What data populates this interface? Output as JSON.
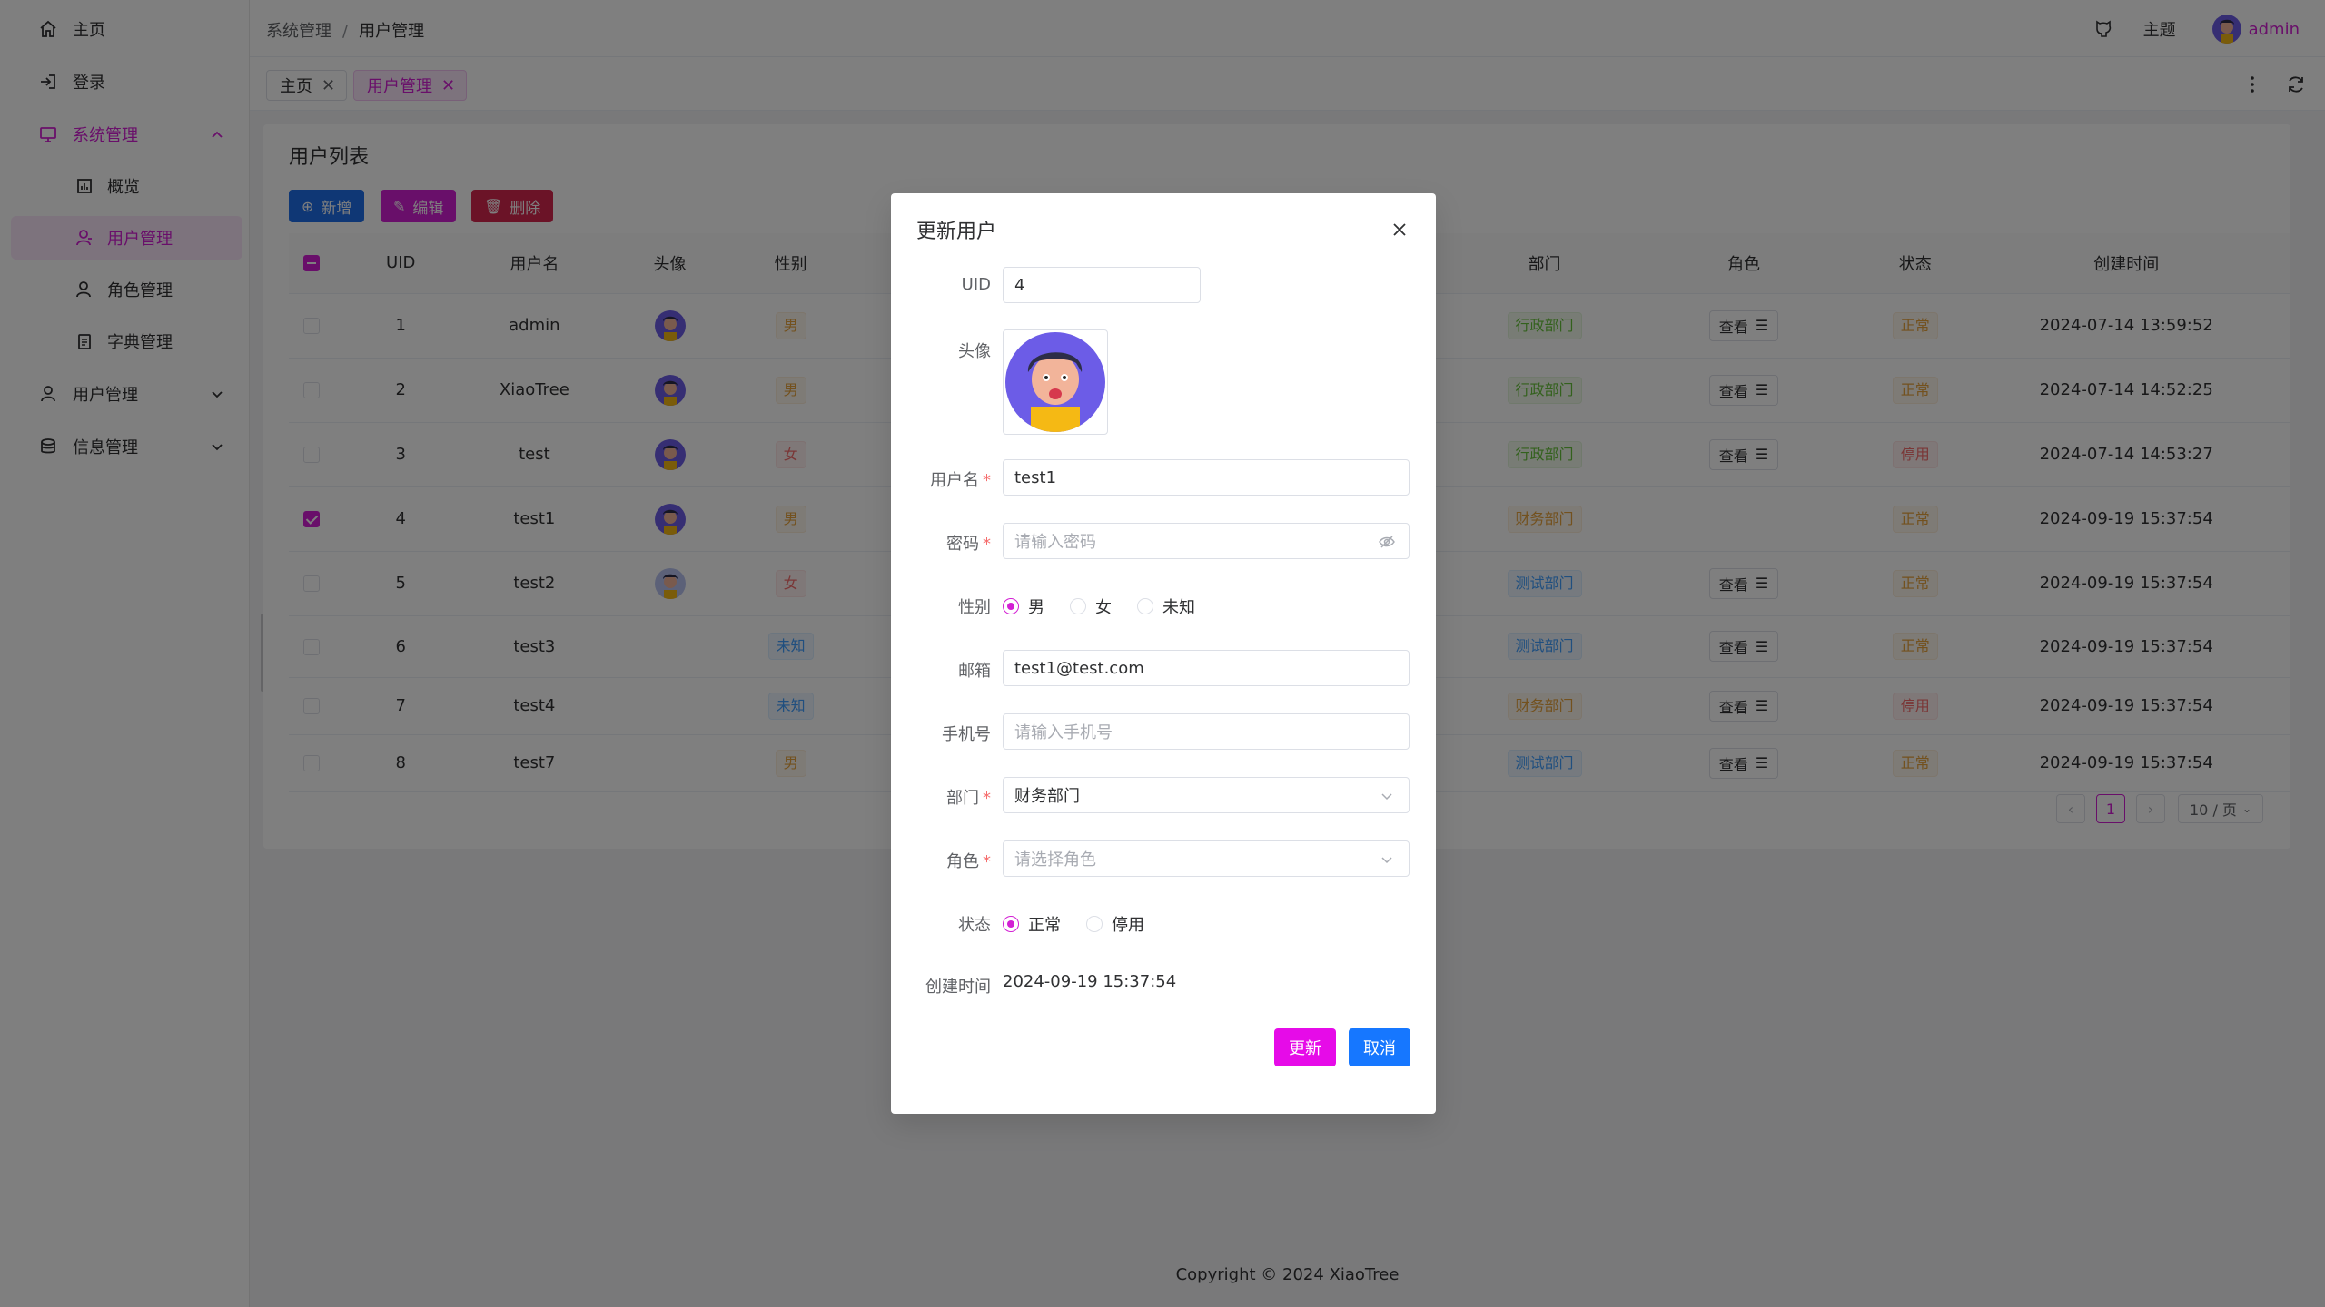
{
  "sidebar": {
    "items": [
      {
        "label": "主页",
        "icon": "home-icon"
      },
      {
        "label": "登录",
        "icon": "login-icon"
      },
      {
        "label": "系统管理",
        "icon": "monitor-icon"
      },
      {
        "label": "概览",
        "icon": "chart-icon"
      },
      {
        "label": "用户管理",
        "icon": "user-icon"
      },
      {
        "label": "角色管理",
        "icon": "user-role-icon"
      },
      {
        "label": "字典管理",
        "icon": "document-icon"
      },
      {
        "label": "用户管理",
        "icon": "user-icon"
      },
      {
        "label": "信息管理",
        "icon": "database-icon"
      }
    ]
  },
  "header": {
    "breadcrumb": [
      "系统管理",
      "用户管理"
    ],
    "theme_label": "主题",
    "user_label": "admin"
  },
  "tabs": [
    {
      "label": "主页"
    },
    {
      "label": "用户管理"
    }
  ],
  "page": {
    "title": "用户列表",
    "buttons": {
      "add": "新增",
      "edit": "编辑",
      "delete": "删除"
    },
    "columns": [
      "UID",
      "用户名",
      "头像",
      "性别",
      "部门",
      "角色",
      "状态",
      "创建时间"
    ],
    "view_label": "查看",
    "rows": [
      {
        "uid": "1",
        "username": "admin",
        "avatar": "avatar",
        "gender": "男",
        "gender_type": "male",
        "dept": "行政部门",
        "dept_type": "green",
        "role": true,
        "status": "正常",
        "status_type": "orange",
        "created": "2024-07-14 13:59:52",
        "checked": false
      },
      {
        "uid": "2",
        "username": "XiaoTree",
        "avatar": "avatar",
        "gender": "男",
        "gender_type": "male",
        "dept": "行政部门",
        "dept_type": "green",
        "role": true,
        "status": "正常",
        "status_type": "orange",
        "created": "2024-07-14 14:52:25",
        "checked": false
      },
      {
        "uid": "3",
        "username": "test",
        "avatar": "avatar",
        "gender": "女",
        "gender_type": "female",
        "dept": "行政部门",
        "dept_type": "green",
        "role": true,
        "status": "停用",
        "status_type": "red",
        "created": "2024-07-14 14:53:27",
        "checked": false
      },
      {
        "uid": "4",
        "username": "test1",
        "avatar": "avatar",
        "gender": "男",
        "gender_type": "male",
        "dept": "财务部门",
        "dept_type": "orange",
        "role": false,
        "status": "正常",
        "status_type": "orange",
        "created": "2024-09-19 15:37:54",
        "checked": true
      },
      {
        "uid": "5",
        "username": "test2",
        "avatar": "avatar-alt",
        "gender": "女",
        "gender_type": "female",
        "dept": "测试部门",
        "dept_type": "blue",
        "role": true,
        "status": "正常",
        "status_type": "orange",
        "created": "2024-09-19 15:37:54",
        "checked": false
      },
      {
        "uid": "6",
        "username": "test3",
        "avatar": "",
        "gender": "未知",
        "gender_type": "unknown",
        "dept": "测试部门",
        "dept_type": "blue",
        "role": true,
        "status": "正常",
        "status_type": "orange",
        "created": "2024-09-19 15:37:54",
        "checked": false
      },
      {
        "uid": "7",
        "username": "test4",
        "avatar": "",
        "gender": "未知",
        "gender_type": "unknown",
        "dept": "财务部门",
        "dept_type": "orange",
        "role": true,
        "status": "停用",
        "status_type": "red",
        "created": "2024-09-19 15:37:54",
        "checked": false
      },
      {
        "uid": "8",
        "username": "test7",
        "avatar": "",
        "gender": "男",
        "gender_type": "male",
        "dept": "测试部门",
        "dept_type": "blue",
        "role": true,
        "status": "正常",
        "status_type": "orange",
        "created": "2024-09-19 15:37:54",
        "checked": false
      }
    ],
    "pager": {
      "current": "1",
      "size": "10 / 页"
    }
  },
  "footer": "Copyright © 2024 XiaoTree",
  "dialog": {
    "title": "更新用户",
    "labels": {
      "uid": "UID",
      "avatar": "头像",
      "username": "用户名",
      "password": "密码",
      "gender": "性别",
      "email": "邮箱",
      "phone": "手机号",
      "dept": "部门",
      "role": "角色",
      "status": "状态",
      "created": "创建时间"
    },
    "values": {
      "uid": "4",
      "username": "test1",
      "email": "test1@test.com",
      "dept": "财务部门",
      "created": "2024-09-19 15:37:54"
    },
    "placeholders": {
      "password": "请输入密码",
      "phone": "请输入手机号",
      "role": "请选择角色"
    },
    "gender_options": [
      "男",
      "女",
      "未知"
    ],
    "gender_selected": "男",
    "status_options": [
      "正常",
      "停用"
    ],
    "status_selected": "正常",
    "update_label": "更新",
    "cancel_label": "取消"
  },
  "colors": {
    "accent": "#d31fd4",
    "add_button": "#1f6feb",
    "delete_button": "#d7264f",
    "cancel_button": "#1677ff"
  }
}
